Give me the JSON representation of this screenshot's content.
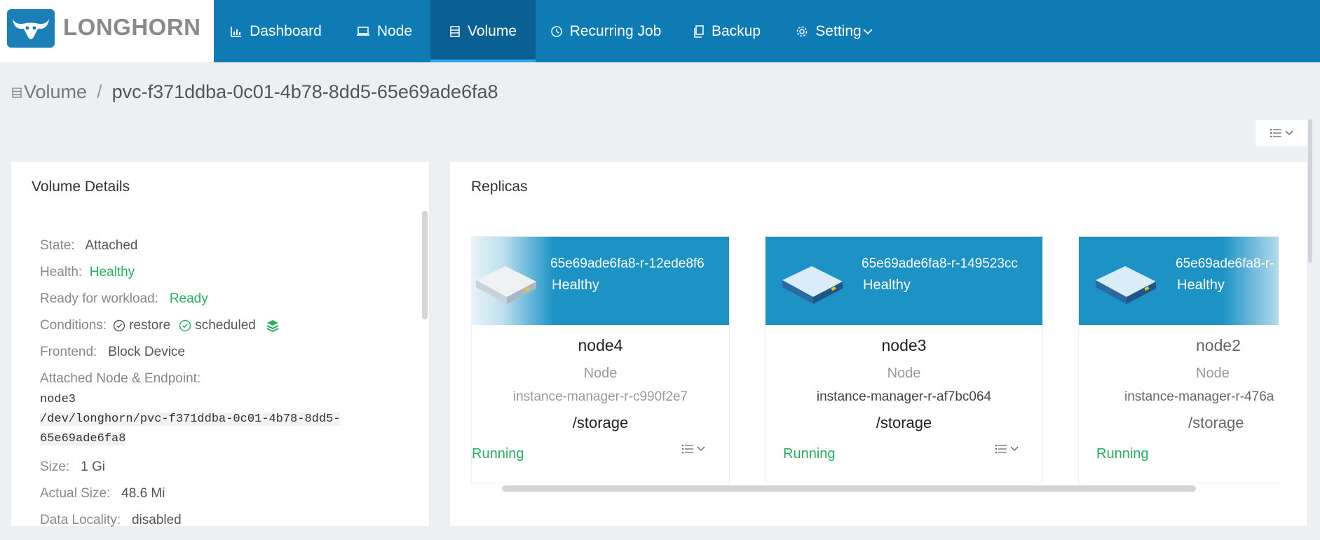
{
  "brand": {
    "name": "LONGHORN"
  },
  "nav": [
    {
      "label": "Dashboard",
      "icon": "bar-chart-icon"
    },
    {
      "label": "Node",
      "icon": "laptop-icon"
    },
    {
      "label": "Volume",
      "icon": "database-icon",
      "active": true
    },
    {
      "label": "Recurring Job",
      "icon": "history-icon"
    },
    {
      "label": "Backup",
      "icon": "copy-icon"
    },
    {
      "label": "Setting",
      "icon": "gear-icon",
      "dropdown": true
    }
  ],
  "breadcrumb": {
    "root": "Volume",
    "separator": "/",
    "current": "pvc-f371ddba-0c01-4b78-8dd5-65e69ade6fa8"
  },
  "details": {
    "title": "Volume Details",
    "state_label": "State:",
    "state": "Attached",
    "health_label": "Health:",
    "health": "Healthy",
    "ready_label": "Ready for workload:",
    "ready": "Ready",
    "conditions_label": "Conditions:",
    "cond1": "restore",
    "cond2": "scheduled",
    "frontend_label": "Frontend:",
    "frontend": "Block Device",
    "attached_label": "Attached Node & Endpoint:",
    "attached_node": "node3",
    "endpoint_line1": "/dev/longhorn/pvc-f371ddba-0c01-4b78-8dd5-",
    "endpoint_line2": "65e69ade6fa8",
    "size_label": "Size:",
    "size": "1 Gi",
    "actual_label": "Actual Size:",
    "actual": "48.6 Mi",
    "locality_label": "Data Locality:",
    "locality": "disabled"
  },
  "replicas": {
    "title": "Replicas",
    "items": [
      {
        "name": "65e69ade6fa8-r-12ede8f6",
        "health": "Healthy",
        "node": "node4",
        "node_label": "Node",
        "instance": "instance-manager-r-c990f2e7",
        "path": "/storage",
        "status": "Running"
      },
      {
        "name": "65e69ade6fa8-r-149523cc",
        "health": "Healthy",
        "node": "node3",
        "node_label": "Node",
        "instance": "instance-manager-r-af7bc064",
        "path": "/storage",
        "status": "Running"
      },
      {
        "name": "65e69ade6fa8-r-",
        "health": "Healthy",
        "node": "node2",
        "node_label": "Node",
        "instance": "instance-manager-r-476a",
        "path": "/storage",
        "status": "Running"
      }
    ]
  },
  "colors": {
    "nav_bg": "#0f7bb4",
    "nav_active": "#0a5f93",
    "success": "#27ae60"
  }
}
